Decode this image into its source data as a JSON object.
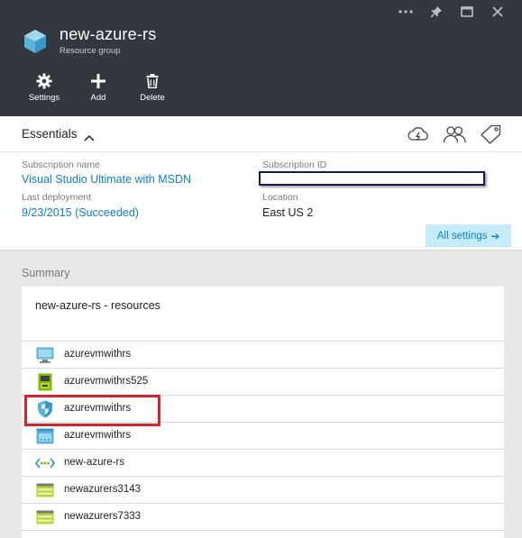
{
  "header": {
    "title": "new-azure-rs",
    "subtitle": "Resource group",
    "window_controls": [
      "more-icon",
      "pin-icon",
      "maximize-icon",
      "close-icon"
    ],
    "commands": [
      {
        "label": "Settings",
        "icon": "gear-icon"
      },
      {
        "label": "Add",
        "icon": "plus-icon"
      },
      {
        "label": "Delete",
        "icon": "trash-icon"
      }
    ]
  },
  "essentials": {
    "title": "Essentials",
    "subscription_name_label": "Subscription name",
    "subscription_name": "Visual Studio Ultimate with MSDN",
    "subscription_id_label": "Subscription ID",
    "last_deployment_label": "Last deployment",
    "last_deployment": "9/23/2015 (Succeeded)",
    "location_label": "Location",
    "location": "East US 2",
    "all_settings": "All settings",
    "arrow": "➔"
  },
  "summary": {
    "label": "Summary",
    "card_title": "new-azure-rs - resources",
    "resources": [
      {
        "name": "azurevmwithrs",
        "icon": "virtual-machine-icon"
      },
      {
        "name": "azurevmwithrs525",
        "icon": "network-interface-icon"
      },
      {
        "name": "azurevmwithrs",
        "icon": "network-security-group-icon"
      },
      {
        "name": "azurevmwithrs",
        "icon": "public-ip-icon"
      },
      {
        "name": "new-azure-rs",
        "icon": "virtual-network-icon"
      },
      {
        "name": "newazurers3143",
        "icon": "storage-account-icon"
      },
      {
        "name": "newazurers7333",
        "icon": "storage-account-icon"
      }
    ]
  },
  "colors": {
    "header_bg": "#32383d",
    "link": "#0b7fcf",
    "highlight": "#d9232b"
  }
}
